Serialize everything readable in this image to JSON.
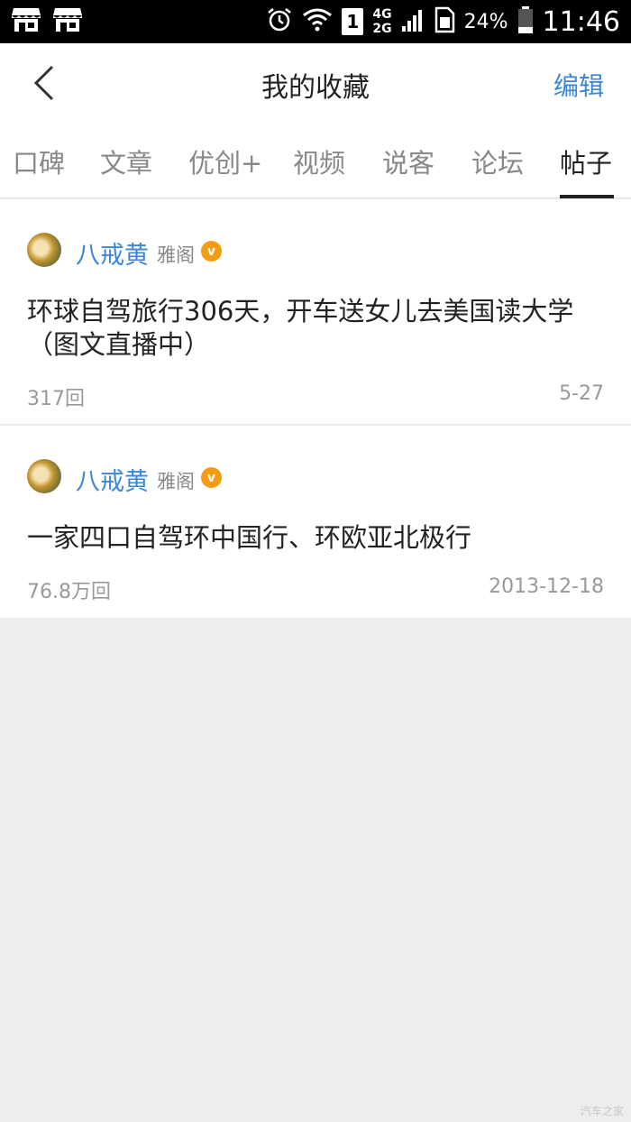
{
  "status_bar": {
    "left_icons": [
      "store-icon",
      "store-icon"
    ],
    "alarm_icon": "alarm-icon",
    "wifi_icon": "wifi-icon",
    "sim_label": "1",
    "net_top": "4G",
    "net_bottom": "2G",
    "battery_percent": "24%",
    "time": "11:46"
  },
  "navbar": {
    "title": "我的收藏",
    "edit_label": "编辑"
  },
  "tabs": [
    {
      "label": "口碑"
    },
    {
      "label": "文章"
    },
    {
      "label": "优创+"
    },
    {
      "label": "视频"
    },
    {
      "label": "说客"
    },
    {
      "label": "论坛"
    },
    {
      "label": "帖子",
      "active": true
    }
  ],
  "posts": [
    {
      "author": "八戒黄",
      "level": "雅阁",
      "badge": "v",
      "title": "环球自驾旅行306天，开车送女儿去美国读大学（图文直播中）",
      "replies": "317回",
      "date": "5-27"
    },
    {
      "author": "八戒黄",
      "level": "雅阁",
      "badge": "v",
      "title": "一家四口自驾环中国行、环欧亚北极行",
      "replies": "76.8万回",
      "date": "2013-12-18"
    }
  ],
  "colors": {
    "accent_blue": "#3b86d8",
    "badge_orange": "#f39c12",
    "background": "#ededef"
  },
  "watermark": "汽车之家"
}
